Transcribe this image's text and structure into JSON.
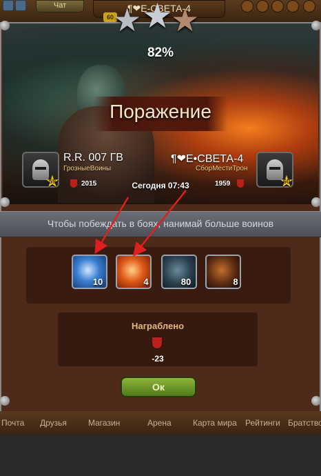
{
  "topbar": {
    "chat_label": "Чат",
    "player_title": "¶❤E-СВЕТА-4",
    "level": "60"
  },
  "battle": {
    "percent": "82%",
    "result": "Поражение",
    "time": "Сегодня 07:43",
    "left_player": {
      "name": "R.R. 007 ГВ",
      "clan": "ГрозныеВоины",
      "level": "59",
      "score": "2015"
    },
    "right_player": {
      "name": "¶❤Е•СВЕТА-4",
      "clan": "СборМестиТрон",
      "level": "60",
      "score": "1959"
    }
  },
  "hint": "Чтобы побеждать в боях, нанимай больше воинов",
  "troops": [
    {
      "icon": "lightning-troop-icon",
      "count": "10"
    },
    {
      "icon": "meteor-troop-icon",
      "count": "4"
    },
    {
      "icon": "archer-troop-icon",
      "count": "80"
    },
    {
      "icon": "warrior-troop-icon",
      "count": "8"
    }
  ],
  "loot": {
    "title": "Награблено",
    "value": "-23"
  },
  "ok_label": "Ок",
  "nav": {
    "mail": "Почта",
    "friends": "Друзья",
    "shop": "Магазин",
    "arena": "Арена",
    "map": "Карта мира",
    "ratings": "Рейтинги",
    "brotherhood": "Братство"
  },
  "colors": {
    "accent_green": "#7aa12c",
    "shield_red": "#b8221a",
    "star_gold": "#f2c419"
  }
}
